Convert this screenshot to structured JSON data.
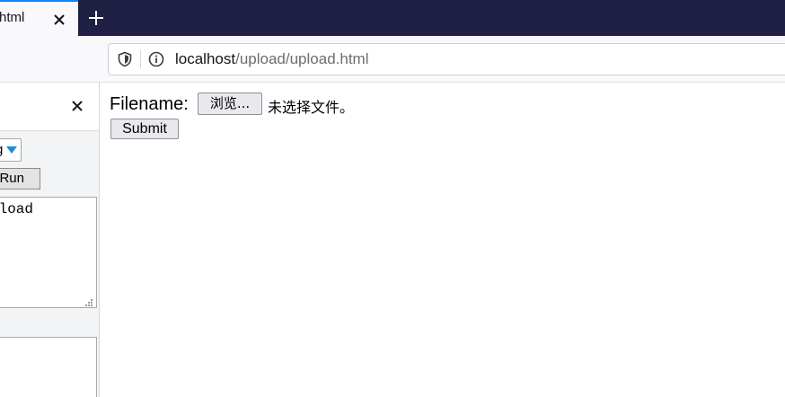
{
  "browser": {
    "tab": {
      "title": "html",
      "accent_color": "#0a84ff"
    },
    "tabstrip_color": "#1f2044",
    "new_tab_icon": "plus-icon",
    "close_tab_icon": "close-icon",
    "urlbar": {
      "host": "localhost",
      "path": "/upload/upload.html",
      "security_icon": "shield-icon",
      "info_icon": "info-icon"
    }
  },
  "sidebar": {
    "close_icon": "close-icon",
    "language_select": {
      "selected_value": "g",
      "arrow_color": "#1a8fd7"
    },
    "run_button_label": "Run",
    "code_text": "pload"
  },
  "page": {
    "filename_label": "Filename:",
    "browse_button_label": "浏览...",
    "no_file_text": "未选择文件。",
    "submit_button_label": "Submit"
  }
}
